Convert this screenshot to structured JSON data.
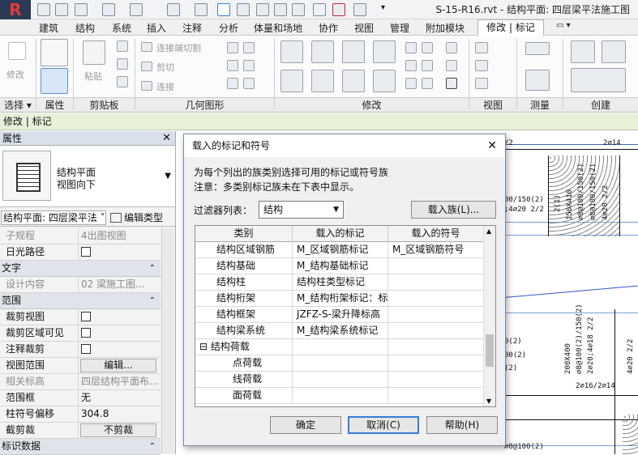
{
  "window": {
    "title": "S-15-R16.rvt - 结构平面: 四层梁平法施工图",
    "app_logo": "R"
  },
  "ribbon": {
    "tabs": [
      "建筑",
      "结构",
      "系统",
      "插入",
      "注释",
      "分析",
      "体量和场地",
      "协作",
      "视图",
      "管理",
      "附加模块"
    ],
    "active_tab": "修改 | 标记",
    "groups": [
      "选择",
      "属性",
      "剪贴板",
      "几何图形",
      "修改",
      "视图",
      "测量",
      "创建"
    ],
    "modify_label": "修改",
    "paste_label": "粘贴",
    "geometry_items": [
      "连接端切割",
      "剪切",
      "连接"
    ]
  },
  "context_bar": {
    "label": "修改 | 标记"
  },
  "properties": {
    "title": "属性",
    "type_name_line1": "结构平面",
    "type_name_line2": "视图向下",
    "instance_selector": "结构平面: 四层梁平法",
    "edit_type": "编辑类型",
    "rows": [
      {
        "label": "子规程",
        "value": "4出图视图",
        "gray": true
      },
      {
        "label": "日光路径",
        "check": true
      },
      {
        "section": "文字"
      },
      {
        "label": "设计内容",
        "value": "02 梁施工图...",
        "gray": true
      },
      {
        "section": "范围"
      },
      {
        "label": "裁剪视图",
        "check": true
      },
      {
        "label": "裁剪区域可见",
        "check": true
      },
      {
        "label": "注释裁剪",
        "check": true
      },
      {
        "label": "视图范围",
        "button": "编辑..."
      },
      {
        "label": "相关标高",
        "value": "四层结构平面布...",
        "gray": true
      },
      {
        "label": "范围框",
        "value": "无"
      },
      {
        "label": "柱符号偏移",
        "value": "304.8"
      },
      {
        "label": "截剪裁",
        "button": "不剪裁"
      },
      {
        "section": "标识数据"
      }
    ]
  },
  "dialog": {
    "title": "载入的标记和符号",
    "desc1": "为每个列出的族类别选择可用的标记或符号族",
    "desc2": "注意：多类别标记族未在下表中显示。",
    "filter_label": "过滤器列表：",
    "filter_value": "结构",
    "load_family_button": "载入族(L)...",
    "columns": [
      "类别",
      "载入的标记",
      "载入的符号"
    ],
    "rows": [
      {
        "category": "结构区域钢筋",
        "tag": "M_区域钢筋标记",
        "symbol": "M_区域钢筋符号",
        "indent": 1
      },
      {
        "category": "结构基础",
        "tag": "M_结构基础标记",
        "symbol": "",
        "indent": 1
      },
      {
        "category": "结构柱",
        "tag": "结构柱类型标记",
        "symbol": "",
        "indent": 1
      },
      {
        "category": "结构桁架",
        "tag": "M_结构桁架标记：标",
        "symbol": "",
        "indent": 1
      },
      {
        "category": "结构框架",
        "tag": "JZFZ-S-梁升降标高",
        "symbol": "",
        "indent": 1
      },
      {
        "category": "结构梁系统",
        "tag": "M_结构梁系统标记",
        "symbol": "",
        "indent": 1
      },
      {
        "category": "结构荷载",
        "tag": "",
        "symbol": "",
        "indent": 0
      },
      {
        "category": "点荷载",
        "tag": "",
        "symbol": "",
        "indent": 2
      },
      {
        "category": "线荷载",
        "tag": "",
        "symbol": "",
        "indent": 2
      },
      {
        "category": "面荷载",
        "tag": "",
        "symbol": "",
        "indent": 2
      }
    ],
    "ok_button": "确定",
    "cancel_button": "取消(C)",
    "help_button": "帮助(H)"
  },
  "drawing": {
    "annotations": [
      "2⌀14",
      "2(1)",
      "150X410",
      "⌀8@100/150(2)",
      "⌀8@100/150(2)",
      "4⌀20 2/2",
      "2⌀14",
      "4⌀20 2/2",
      "2⌀16/2⌀14",
      "4⌀20 2/2",
      "⌀8@100(2)",
      "2⌀20;4⌀18 2/2",
      "200X400",
      "⌀8@100(2)/150(2)",
      "⌀8@100(2)"
    ]
  },
  "colors": {
    "context_bar": "#e7f0d9",
    "drawing_lines": "#3b6bb5",
    "title_bar": "#f2f3f5"
  }
}
